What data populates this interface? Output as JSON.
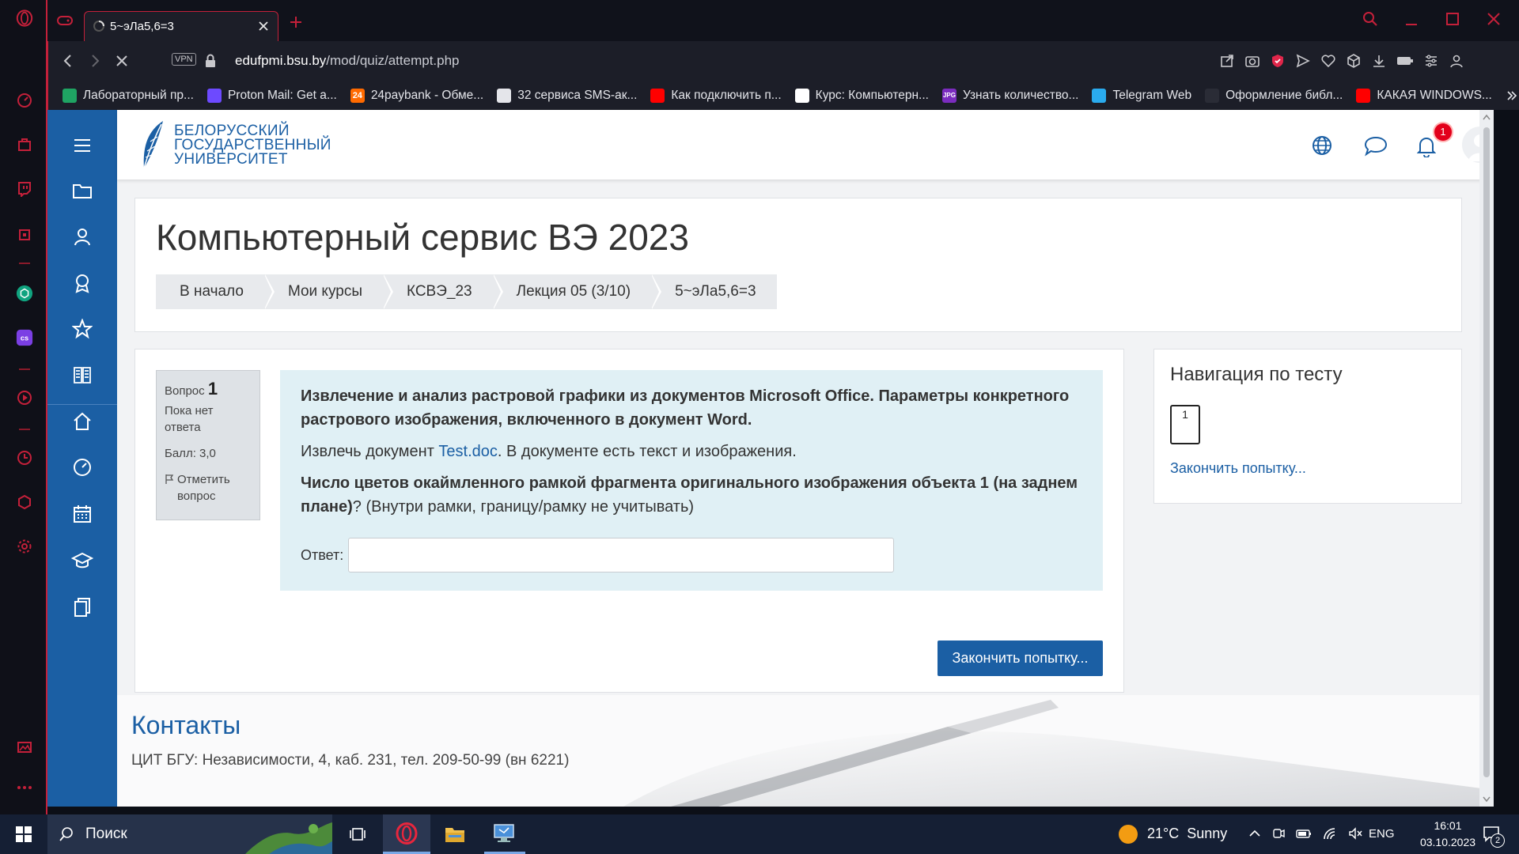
{
  "browser": {
    "tab_title": "5~эЛа5,6=3",
    "url_host": "edufpmi.bsu.by",
    "url_path": "/mod/quiz/attempt.php",
    "vpn_label": "VPN",
    "accent_color": "#c4203a"
  },
  "bookmarks": [
    {
      "label": "Лабораторный пр...",
      "icon": "google-drive-icon",
      "color": "#1fa463"
    },
    {
      "label": "Proton Mail: Get a...",
      "icon": "proton-icon",
      "color": "#6d4aff"
    },
    {
      "label": "24paybank - Обме...",
      "icon": "24paybank-icon",
      "color": "#ff6a00",
      "glyph": "24"
    },
    {
      "label": "32 сервиса SMS-ак...",
      "icon": "document-icon",
      "color": "#e4e5ea"
    },
    {
      "label": "Как подключить п...",
      "icon": "youtube-icon",
      "color": "#ff0000"
    },
    {
      "label": "Курс: Компьютерн...",
      "icon": "course-icon",
      "color": "#ffffff"
    },
    {
      "label": "Узнать количество...",
      "icon": "jpg-icon",
      "color": "#7b2cbf",
      "glyph": "JPG"
    },
    {
      "label": "Telegram Web",
      "icon": "telegram-icon",
      "color": "#2aabee"
    },
    {
      "label": "Оформление библ...",
      "icon": "globe-icon",
      "color": "#2a2c36"
    },
    {
      "label": "КАКАЯ WINDOWS...",
      "icon": "youtube-icon",
      "color": "#ff0000"
    }
  ],
  "site": {
    "logo_lines": [
      "БЕЛОРУССКИЙ",
      "ГОСУДАРСТВЕННЫЙ",
      "УНИВЕРСИТЕТ"
    ],
    "notification_count": "1",
    "brand_color": "#1b5fa4"
  },
  "page": {
    "title": "Компьютерный сервис ВЭ 2023",
    "breadcrumbs": [
      "В начало",
      "Мои курсы",
      "КСВЭ_23",
      "Лекция 05 (3/10)",
      "5~эЛа5,6=3"
    ]
  },
  "question": {
    "label": "Вопрос",
    "number": "1",
    "status": "Пока нет ответа",
    "score": "Балл: 3,0",
    "flag_label": "Отметить вопрос",
    "heading": "Извлечение и анализ растровой графики из документов Microsoft Office. Параметры конкретного растрового изображения, включенного в документ Word.",
    "intro_before": "Извлечь документ ",
    "intro_link": "Test.doc",
    "intro_after": ". В документе есть текст и изображения.",
    "prompt_bold": "Число цветов окаймленного рамкой фрагмента оригинального изображения объекта 1 (на заднем плане)",
    "prompt_rest": "? (Внутри рамки, границу/рамку не учитывать)",
    "answer_label": "Ответ:",
    "answer_value": ""
  },
  "actions": {
    "finish_label": "Закончить попытку..."
  },
  "quiz_nav": {
    "title": "Навигация по тесту",
    "question_buttons": [
      "1"
    ],
    "finish_link": "Закончить попытку..."
  },
  "footer": {
    "title": "Контакты",
    "text": "ЦИТ БГУ: Независимости, 4, каб. 231, тел. 209-50-99 (вн 6221)"
  },
  "taskbar": {
    "search_placeholder": "Поиск",
    "weather": "21°C  Sunny",
    "lang": "ENG",
    "time": "16:01",
    "date": "03.10.2023",
    "notifications": "2"
  }
}
